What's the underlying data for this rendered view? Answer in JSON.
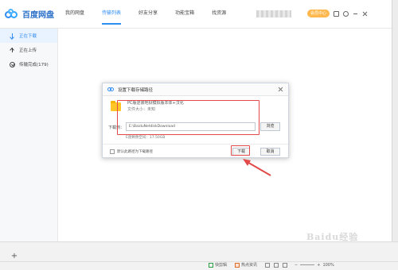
{
  "app": {
    "brand": "百度网盘"
  },
  "nav": {
    "items": [
      "我的网盘",
      "传输列表",
      "好友分享",
      "功能宝箱",
      "找资源"
    ],
    "active": "传输列表"
  },
  "header": {
    "member_label": "会员中心"
  },
  "sidebar": {
    "items": [
      {
        "label": "正在下载",
        "icon": "download-icon"
      },
      {
        "label": "正在上传",
        "icon": "upload-icon"
      },
      {
        "label": "传输完成(179)",
        "icon": "check-circle-icon"
      }
    ]
  },
  "dialog": {
    "title": "设置下载存储路径",
    "file_name": "PC版逆袭地狱模拟版本体+汉化",
    "file_size": "文件大小：未知",
    "download_label": "下载到：",
    "path_value": "E:\\BaiduNetdiskDownload",
    "browse_label": "浏览",
    "space_text": "E盘剩余空间：17.50GB",
    "default_label": "默认此路径为下载路径",
    "download_btn": "下载",
    "cancel_btn": "取消"
  },
  "statusbar": {
    "items": [
      "快剪辑",
      "热点资讯"
    ],
    "zoom": "100%"
  },
  "watermark": "Baidu经验",
  "colors": {
    "accent": "#2f8cf2",
    "annotation": "#e24a4a",
    "member": "#ffb84d"
  }
}
